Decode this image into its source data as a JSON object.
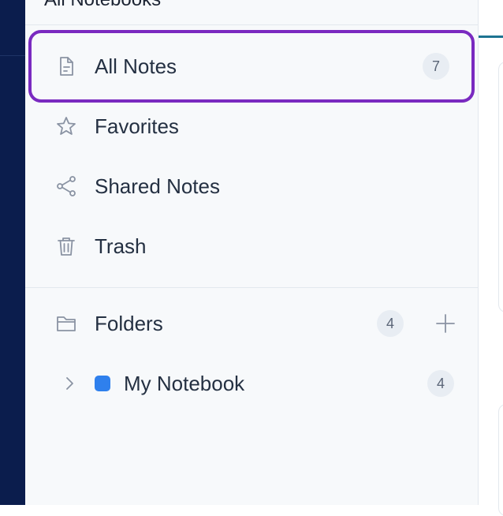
{
  "sidebar": {
    "header_title": "All Notebooks",
    "nav": {
      "all_notes": {
        "label": "All Notes",
        "count": "7",
        "icon": "file-text-icon"
      },
      "favorites": {
        "label": "Favorites",
        "icon": "star-icon"
      },
      "shared": {
        "label": "Shared Notes",
        "icon": "share-icon"
      },
      "trash": {
        "label": "Trash",
        "icon": "trash-icon"
      }
    },
    "folders": {
      "label": "Folders",
      "count": "4",
      "icon": "folder-icon",
      "add_icon": "plus-icon",
      "items": [
        {
          "label": "My Notebook",
          "count": "4",
          "color": "#2f80ed",
          "icon": "chevron-right-icon"
        }
      ]
    }
  },
  "colors": {
    "rail": "#0b1d4d",
    "selected_outline": "#7a2ac0",
    "accent": "#1d7391"
  }
}
